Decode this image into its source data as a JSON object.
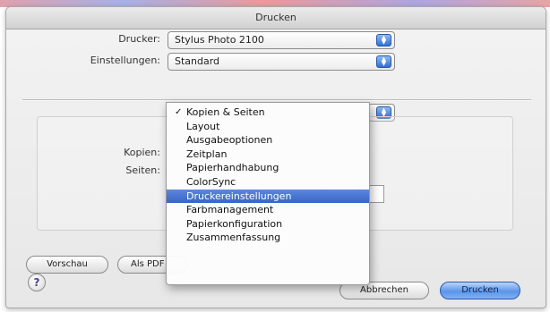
{
  "window": {
    "title": "Drucken"
  },
  "printer": {
    "label": "Drucker:",
    "value": "Stylus Photo 2100"
  },
  "presets": {
    "label": "Einstellungen:",
    "value": "Standard"
  },
  "fields": {
    "copies_label": "Kopien:",
    "pages_label": "Seiten:"
  },
  "menu": {
    "items": [
      {
        "label": "Kopien & Seiten",
        "checked": true
      },
      {
        "label": "Layout"
      },
      {
        "label": "Ausgabeoptionen"
      },
      {
        "label": "Zeitplan"
      },
      {
        "label": "Papierhandhabung"
      },
      {
        "label": "ColorSync"
      },
      {
        "label": "Druckereinstellungen",
        "highlighted": true
      },
      {
        "label": "Farbmanagement"
      },
      {
        "label": "Papierkonfiguration"
      },
      {
        "label": "Zusammenfassung"
      }
    ],
    "checkmark": "✓"
  },
  "buttons": {
    "preview": "Vorschau",
    "pdf": "Als PDF",
    "cancel": "Abbrechen",
    "print": "Drucken",
    "help": "?"
  },
  "icons": {
    "popup_arrows": "popup-arrows-icon",
    "help": "help-icon"
  },
  "colors": {
    "accent": "#3865c6",
    "default_button": "#5c95e8"
  }
}
